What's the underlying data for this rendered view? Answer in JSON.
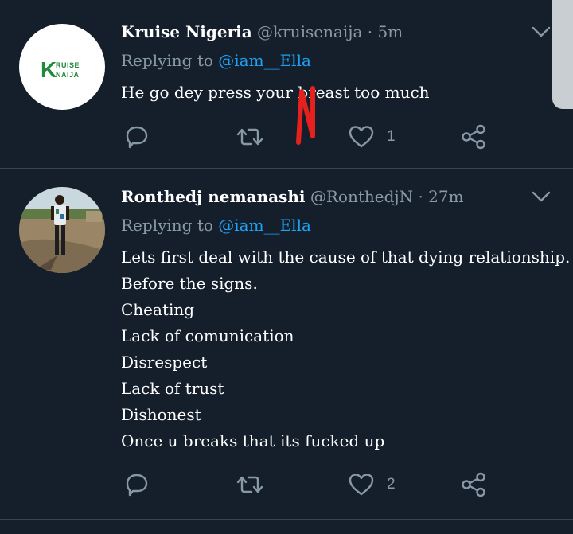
{
  "tweets": [
    {
      "name": "Kruise Nigeria",
      "handle": "@kruisenaija",
      "separator": "·",
      "time": "5m",
      "replying_prefix": "Replying to",
      "replying_to": "@iam__Ella",
      "body_lines": [
        "He go dey press your breast too much"
      ],
      "avatar_logo_top": "RUISE",
      "avatar_logo_k": "K",
      "avatar_logo_bottom": "NAIJA",
      "avatar_logo_color": "#1f8a3a",
      "like_count": "1",
      "icons": [
        "reply-icon",
        "retweet-icon",
        "like-icon",
        "share-icon",
        "chevron-down-icon"
      ]
    },
    {
      "name": "Ronthedj nemanashi",
      "handle": "@RonthedjN",
      "separator": "·",
      "time": "27m",
      "replying_prefix": "Replying to",
      "replying_to": "@iam__Ella",
      "body_lines": [
        "Lets first deal with the cause of that dying relationship.",
        "Before the signs.",
        "Cheating",
        "Lack of comunication",
        "Disrespect",
        "Lack of trust",
        "Dishonest",
        "Once u breaks that its fucked up"
      ],
      "like_count": "2",
      "icons": [
        "reply-icon",
        "retweet-icon",
        "like-icon",
        "share-icon",
        "chevron-down-icon"
      ]
    }
  ],
  "colors": {
    "background": "#151f2b",
    "divider": "#38444d",
    "muted_text": "#8899a6",
    "mention": "#1da1f2",
    "annotation_red": "#e5211f"
  }
}
